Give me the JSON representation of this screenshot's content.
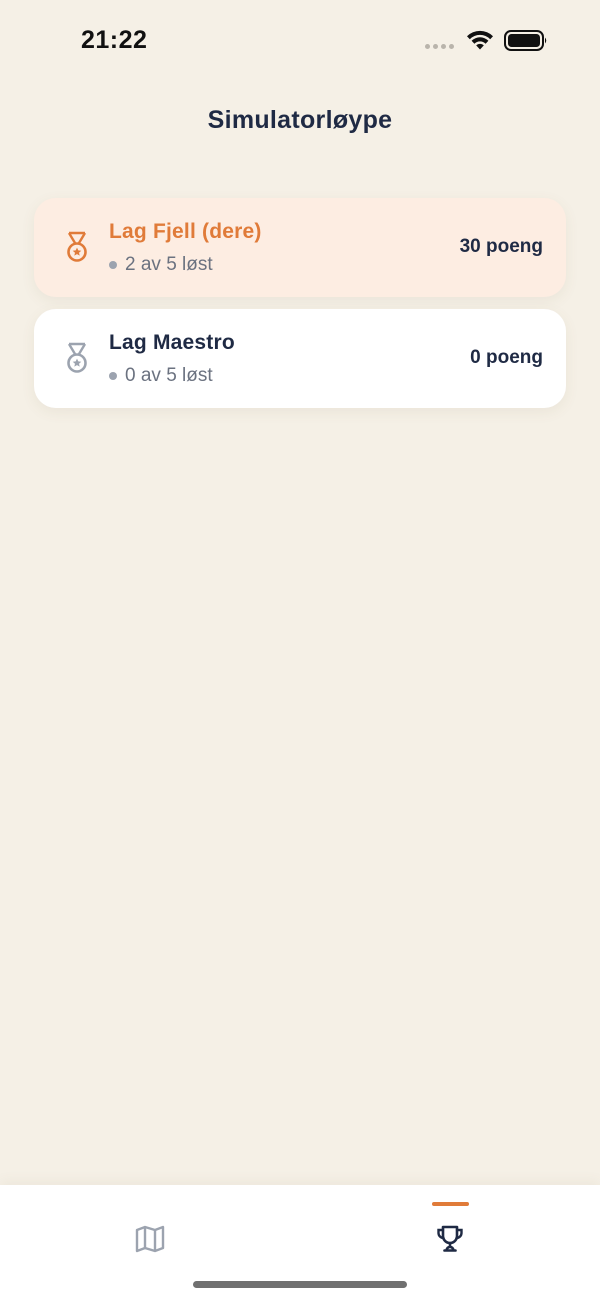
{
  "status_bar": {
    "time": "21:22"
  },
  "header": {
    "title": "Simulatorløype"
  },
  "teams": [
    {
      "name": "Lag Fjell (dere)",
      "progress": "2 av 5 løst",
      "points": "30 poeng",
      "medal_icon": "bronze-medal-icon",
      "highlighted": true
    },
    {
      "name": "Lag Maestro",
      "progress": "0 av 5 løst",
      "points": "0 poeng",
      "medal_icon": "silver-medal-icon",
      "highlighted": false
    }
  ],
  "tab_bar": {
    "tabs": [
      {
        "icon": "map-icon",
        "active": false
      },
      {
        "icon": "trophy-icon",
        "active": true
      }
    ]
  },
  "colors": {
    "accent": "#e07b39",
    "background": "#f5f0e6",
    "highlight_card": "#fdede2",
    "text_primary": "#1f2a44",
    "text_secondary": "#6b7280",
    "icon_inactive": "#9ca3af"
  }
}
